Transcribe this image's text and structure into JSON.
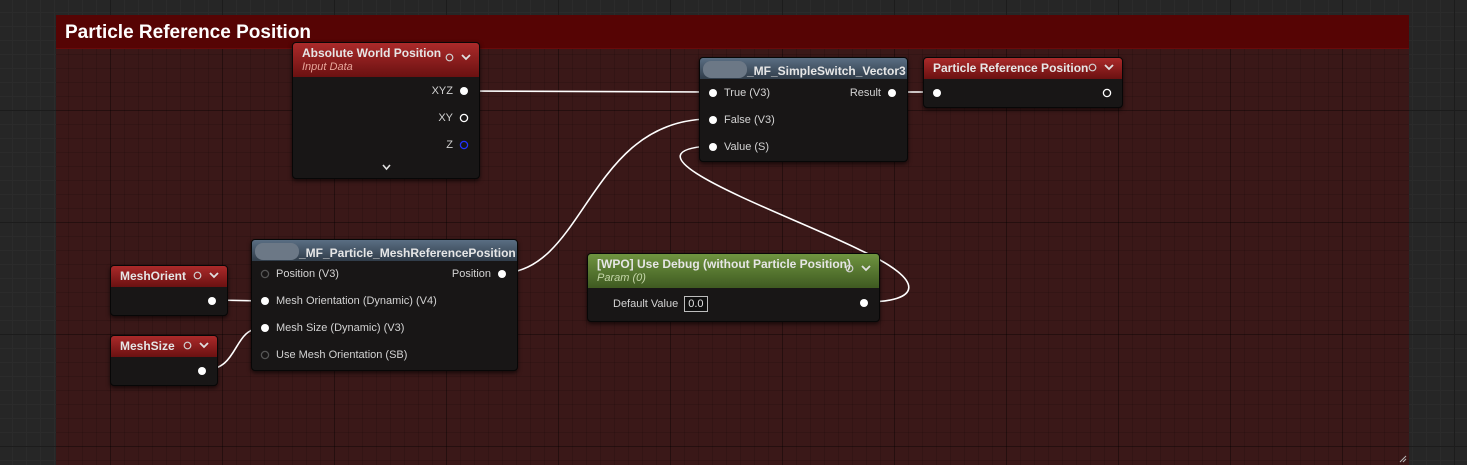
{
  "comment": {
    "title": "Particle Reference Position"
  },
  "nodes": {
    "absolute_world_position": {
      "title": "Absolute World Position",
      "subtitle": "Input Data",
      "outputs": [
        "XYZ",
        "XY",
        "Z"
      ]
    },
    "simple_switch": {
      "title": "_MF_SimpleSwitch_Vector3",
      "inputs": [
        "True (V3)",
        "False (V3)",
        "Value (S)"
      ],
      "output": "Result"
    },
    "particle_reference_position": {
      "title": "Particle Reference Position"
    },
    "mesh_reference_position": {
      "title": "_MF_Particle_MeshReferencePosition",
      "inputs": [
        "Position (V3)",
        "Mesh Orientation (Dynamic) (V4)",
        "Mesh Size (Dynamic) (V3)",
        "Use Mesh Orientation (SB)"
      ],
      "output": "Position"
    },
    "mesh_orient": {
      "title": "MeshOrient"
    },
    "mesh_size": {
      "title": "MeshSize"
    },
    "use_debug": {
      "title": "[WPO] Use Debug (without Particle Position)",
      "subtitle": "Param (0)",
      "default_label": "Default Value",
      "default_value": "0.0"
    }
  },
  "colors": {
    "comment_header": "#560404",
    "comment_body": "#3a1818",
    "header_red": "#9a2222",
    "header_blue": "#4e6276",
    "header_green": "#5e8236",
    "wire": "#ffffff",
    "z_pin": "#2233ff"
  },
  "icons": [
    "preview-dot-icon",
    "chevron-down-icon",
    "pin-filled-icon",
    "pin-hollow-icon",
    "expand-chevron-icon",
    "resize-grip-icon"
  ]
}
